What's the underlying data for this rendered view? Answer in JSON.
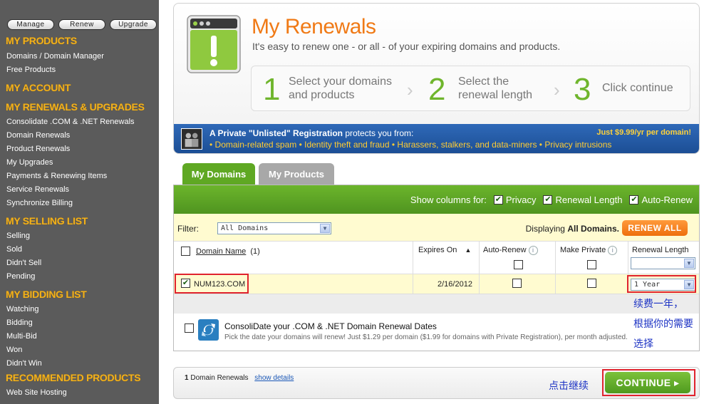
{
  "sidebar": {
    "buttons": [
      "Manage",
      "Renew",
      "Upgrade"
    ],
    "sections": [
      {
        "title": "MY PRODUCTS",
        "items": [
          "Domains / Domain Manager",
          "Free Products"
        ]
      },
      {
        "title": "MY ACCOUNT",
        "items": []
      },
      {
        "title": "MY RENEWALS & UPGRADES",
        "items": [
          "Consolidate .COM & .NET Renewals",
          "Domain Renewals",
          "Product Renewals",
          "My Upgrades",
          "Payments & Renewing Items",
          "Service Renewals",
          "Synchronize Billing"
        ]
      },
      {
        "title": "MY SELLING LIST",
        "items": [
          "Selling",
          "Sold",
          "Didn't Sell",
          "Pending"
        ]
      },
      {
        "title": "MY BIDDING LIST",
        "items": [
          "Watching",
          "Bidding",
          "Multi-Bid",
          "Won",
          "Didn't Win"
        ]
      },
      {
        "title": "RECOMMENDED PRODUCTS",
        "items": [
          "Web Site Hosting"
        ]
      }
    ]
  },
  "header": {
    "title": "My Renewals",
    "subtitle": "It's easy to renew one - or all - of your expiring domains and products.",
    "steps": [
      {
        "num": "1",
        "line1": "Select your domains",
        "line2": "and products"
      },
      {
        "num": "2",
        "line1": "Select the",
        "line2": "renewal length"
      },
      {
        "num": "3",
        "line1": "Click continue",
        "line2": ""
      }
    ]
  },
  "promo": {
    "bold": "A Private \"Unlisted\" Registration",
    "rest": " protects you from:",
    "price": "Just $9.99/yr per domain!",
    "benefits": "• Domain-related spam   • Identity theft and fraud   • Harassers, stalkers, and data-miners   • Privacy intrusions"
  },
  "tabs": {
    "domains": "My Domains",
    "products": "My Products"
  },
  "columns_bar": {
    "label": "Show columns for:",
    "options": [
      "Privacy",
      "Renewal Length",
      "Auto-Renew"
    ]
  },
  "filter": {
    "label": "Filter:",
    "value": "All Domains",
    "displaying_prefix": "Displaying ",
    "displaying_bold": "All Domains.",
    "renew_all": "RENEW ALL"
  },
  "table": {
    "domain_name": "Domain Name",
    "domain_count": "(1)",
    "expires_on": "Expires On",
    "sort_arrow": "▲",
    "auto_renew": "Auto-Renew",
    "make_private": "Make Private",
    "renewal_length": "Renewal Length",
    "row": {
      "domain": "NUM123.COM",
      "expires": "2/16/2012",
      "length": "1 Year"
    }
  },
  "consolidate": {
    "title": "ConsoliDate your .COM & .NET Domain Renewal Dates",
    "desc": "Pick the date your domains will renew! Just $1.29 per domain ($1.99 for domains with Private Registration), per month adjusted."
  },
  "bottom": {
    "count": "1",
    "label": " Domain Renewals",
    "link": "show details",
    "continue": "CONTINUE ▸"
  },
  "annotations": {
    "renew_note_1": "续费一年，",
    "renew_note_2": "根据你的需要",
    "renew_note_3": "选择",
    "continue_note": "点击继续"
  },
  "colors": {
    "accent_orange": "#f07a16",
    "accent_green": "#5fa823",
    "sidebar_bg": "#5b5b5b",
    "section_yellow": "#f2b11c"
  }
}
